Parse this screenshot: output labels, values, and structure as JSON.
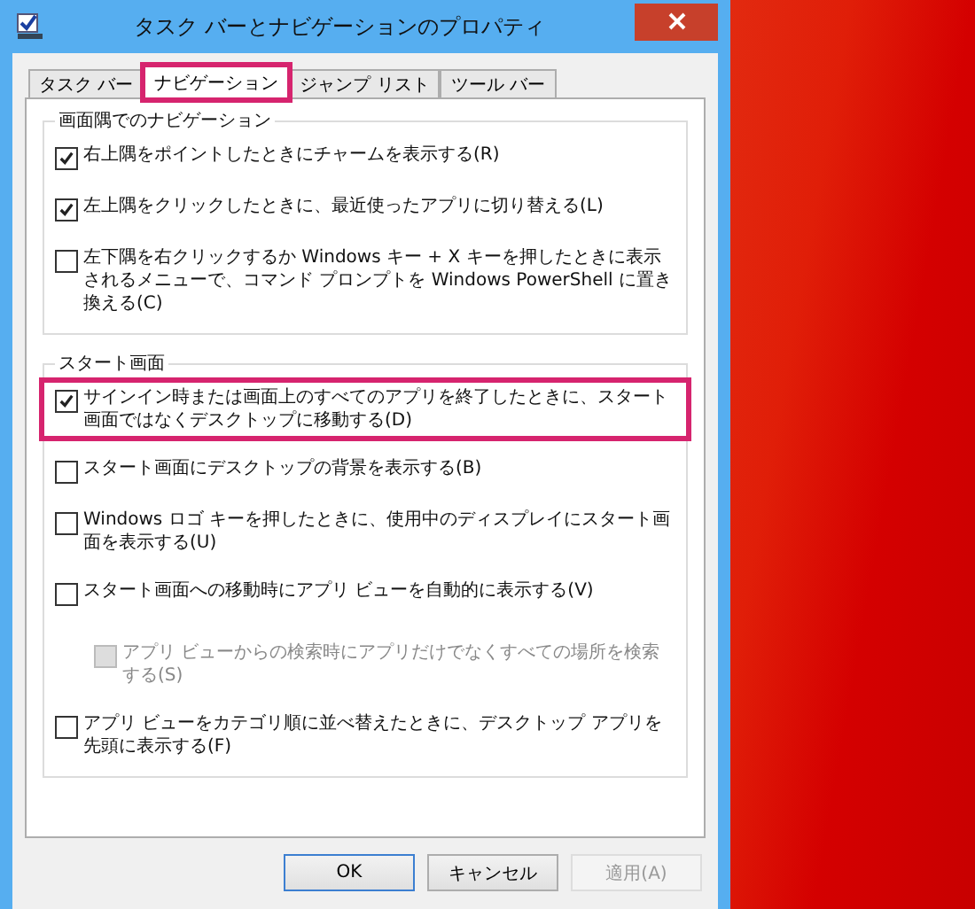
{
  "window": {
    "title": "タスク バーとナビゲーションのプロパティ"
  },
  "tabs": [
    {
      "label": "タスク バー",
      "selected": false,
      "highlighted": false
    },
    {
      "label": "ナビゲーション",
      "selected": true,
      "highlighted": true
    },
    {
      "label": "ジャンプ リスト",
      "selected": false,
      "highlighted": false
    },
    {
      "label": "ツール バー",
      "selected": false,
      "highlighted": false
    }
  ],
  "groups": [
    {
      "title": "画面隅でのナビゲーション",
      "options": [
        {
          "label": "右上隅をポイントしたときにチャームを表示する(R)",
          "checked": true,
          "disabled": false,
          "highlighted": false
        },
        {
          "label": "左上隅をクリックしたときに、最近使ったアプリに切り替える(L)",
          "checked": true,
          "disabled": false,
          "highlighted": false
        },
        {
          "label": "左下隅を右クリックするか Windows キー + X キーを押したときに表示されるメニューで、コマンド プロンプトを Windows PowerShell に置き換える(C)",
          "checked": false,
          "disabled": false,
          "highlighted": false
        }
      ]
    },
    {
      "title": "スタート画面",
      "options": [
        {
          "label": "サインイン時または画面上のすべてのアプリを終了したときに、スタート画面ではなくデスクトップに移動する(D)",
          "checked": true,
          "disabled": false,
          "highlighted": true
        },
        {
          "label": "スタート画面にデスクトップの背景を表示する(B)",
          "checked": false,
          "disabled": false,
          "highlighted": false
        },
        {
          "label": "Windows ロゴ キーを押したときに、使用中のディスプレイにスタート画面を表示する(U)",
          "checked": false,
          "disabled": false,
          "highlighted": false
        },
        {
          "label": "スタート画面への移動時にアプリ ビューを自動的に表示する(V)",
          "checked": false,
          "disabled": false,
          "highlighted": false,
          "children": [
            {
              "label": "アプリ ビューからの検索時にアプリだけでなくすべての場所を検索する(S)",
              "checked": false,
              "disabled": true,
              "highlighted": false
            }
          ]
        },
        {
          "label": "アプリ ビューをカテゴリ順に並べ替えたときに、デスクトップ アプリを先頭に表示する(F)",
          "checked": false,
          "disabled": false,
          "highlighted": false
        }
      ]
    }
  ],
  "buttons": [
    {
      "label": "OK",
      "disabled": false,
      "default": true
    },
    {
      "label": "キャンセル",
      "disabled": false,
      "default": false
    },
    {
      "label": "適用(A)",
      "disabled": true,
      "default": false
    }
  ]
}
